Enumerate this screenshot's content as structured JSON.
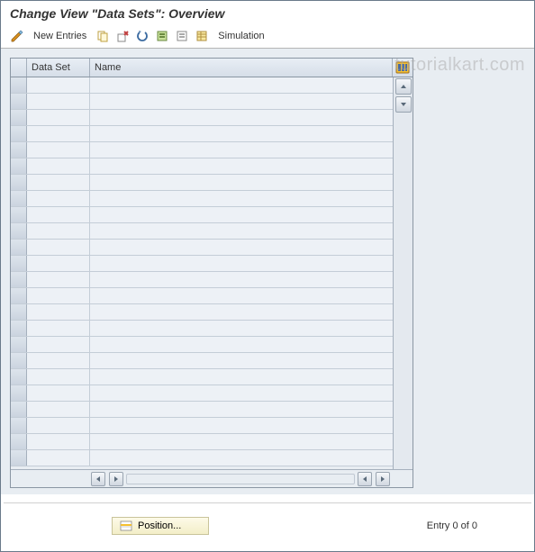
{
  "title": "Change View \"Data Sets\": Overview",
  "toolbar": {
    "new_entries_label": "New Entries",
    "simulation_label": "Simulation"
  },
  "table": {
    "columns": {
      "data_set": "Data Set",
      "name": "Name"
    },
    "row_count": 24
  },
  "footer": {
    "position_label": "Position...",
    "entry_label": "Entry 0 of 0"
  },
  "watermark": "tutorialkart.com"
}
